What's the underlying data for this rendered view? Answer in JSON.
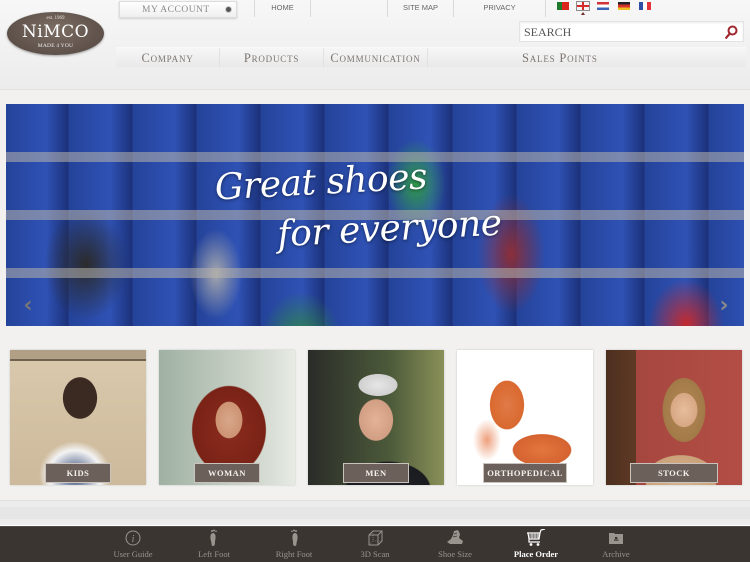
{
  "header": {
    "logo": {
      "established": "est. 1969",
      "brand": "NiMCO",
      "tagline": "MADE 4 YOU"
    },
    "account_label": "MY ACCOUNT",
    "top_links": [
      "HOME",
      "SITE MAP",
      "PRIVACY"
    ],
    "languages": [
      {
        "code": "pt",
        "name": "Portuguese"
      },
      {
        "code": "en",
        "name": "English",
        "selected": true
      },
      {
        "code": "nl",
        "name": "Dutch"
      },
      {
        "code": "de",
        "name": "German"
      },
      {
        "code": "fr",
        "name": "French"
      }
    ],
    "search": {
      "placeholder": "SEARCH",
      "value": ""
    },
    "nav": [
      "Company",
      "Products",
      "Communication",
      "Sales Points"
    ]
  },
  "hero": {
    "tagline_line1": "Great shoes",
    "tagline_line2": "for everyone",
    "prev_arrow": "‹",
    "next_arrow": "›"
  },
  "categories": [
    {
      "label": "KIDS"
    },
    {
      "label": "WOMAN"
    },
    {
      "label": "MEN"
    },
    {
      "label": "ORTHOPEDICAL"
    },
    {
      "label": "STOCK"
    }
  ],
  "tabbar": {
    "items": [
      {
        "label": "User Guide",
        "icon": "info-icon"
      },
      {
        "label": "Left Foot",
        "icon": "left-foot-icon"
      },
      {
        "label": "Right Foot",
        "icon": "right-foot-icon"
      },
      {
        "label": "3D Scan",
        "icon": "cube-icon"
      },
      {
        "label": "Shoe Size",
        "icon": "shoe-icon"
      },
      {
        "label": "Place Order",
        "icon": "cart-icon",
        "active": true
      },
      {
        "label": "Archive",
        "icon": "folder-icon"
      }
    ]
  },
  "colors": {
    "brand_brown": "#6b605a",
    "tabbar_bg": "#3a3531",
    "search_icon": "#a0262e"
  }
}
